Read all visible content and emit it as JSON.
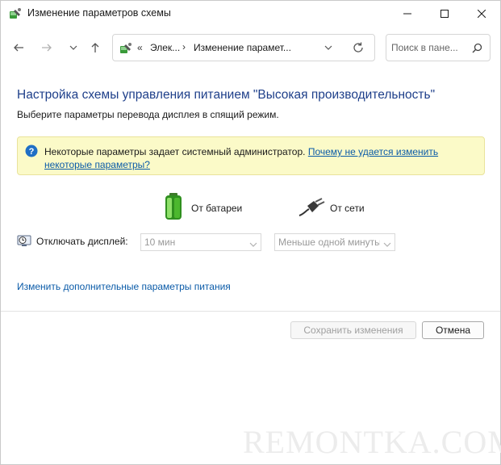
{
  "window": {
    "title": "Изменение параметров схемы"
  },
  "address": {
    "prefix": "«",
    "crumb1": "Элек...",
    "sep": "›",
    "crumb2": "Изменение парамет..."
  },
  "search": {
    "placeholder": "Поиск в пане..."
  },
  "page": {
    "heading": "Настройка схемы управления питанием \"Высокая производительность\"",
    "subheading": "Выберите параметры перевода дисплея в спящий режим."
  },
  "infobar": {
    "text": "Некоторые параметры задает системный администратор. ",
    "link": "Почему не удается изменить некоторые параметры?"
  },
  "columns": {
    "battery_label": "От батареи",
    "ac_label": "От сети"
  },
  "display": {
    "label": "Отключать дисплей:",
    "battery_value": "10 мин",
    "ac_value": "Меньше одной минуты"
  },
  "advanced_link": "Изменить дополнительные параметры питания",
  "buttons": {
    "save": "Сохранить изменения",
    "cancel": "Отмена"
  },
  "watermark": "REMONTKA.COM",
  "colors": {
    "heading": "#1e3f8a",
    "link": "#0b5ba8",
    "infobar_bg": "#fbfac8"
  }
}
